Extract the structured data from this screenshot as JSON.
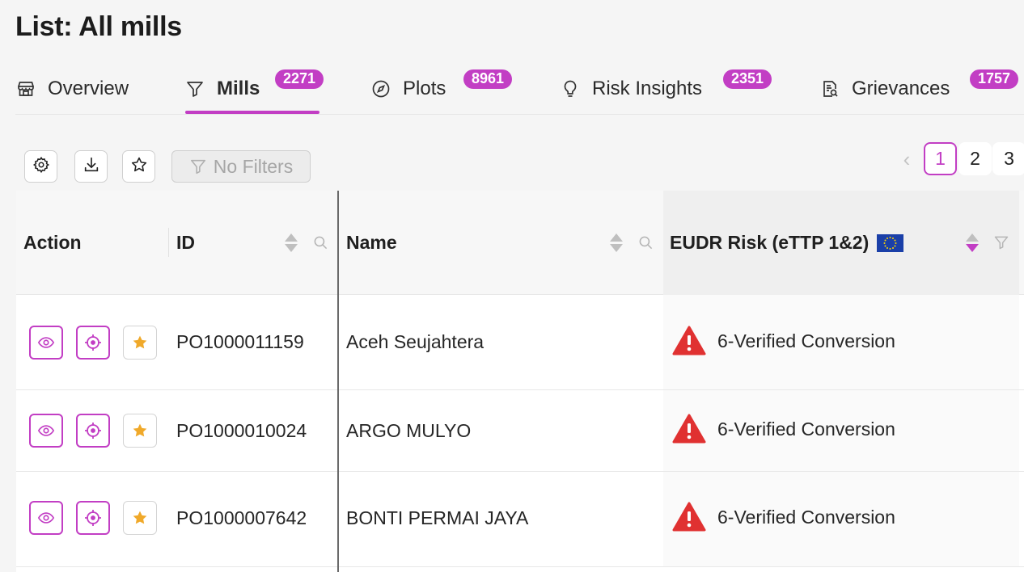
{
  "page": {
    "title": "List: All mills"
  },
  "tabs": [
    {
      "label": "Overview",
      "icon": "store-icon"
    },
    {
      "label": "Mills",
      "icon": "funnel-icon",
      "count": "2271"
    },
    {
      "label": "Plots",
      "icon": "compass-icon",
      "count": "8961"
    },
    {
      "label": "Risk Insights",
      "icon": "lightbulb-icon",
      "count": "2351"
    },
    {
      "label": "Grievances",
      "icon": "document-search-icon",
      "count": "1757"
    }
  ],
  "toolbar": {
    "filter_label": "No Filters"
  },
  "pagination": {
    "pages": [
      "1",
      "2",
      "3"
    ],
    "current": "1"
  },
  "table": {
    "columns": [
      "Action",
      "ID",
      "Name",
      "EUDR Risk (eTTP 1&2)"
    ],
    "rows": [
      {
        "id": "PO1000011159",
        "name": "Aceh Seujahtera",
        "risk": "6-Verified Conversion"
      },
      {
        "id": "PO1000010024",
        "name": "ARGO MULYO",
        "risk": "6-Verified Conversion"
      },
      {
        "id": "PO1000007642",
        "name": "BONTI PERMAI JAYA",
        "risk": "6-Verified Conversion"
      }
    ]
  },
  "colors": {
    "accent": "#c23ec4",
    "warning": "#e03131",
    "star": "#f0a92a",
    "eu_blue": "#1a3fa8",
    "eu_star": "#ffd500"
  }
}
